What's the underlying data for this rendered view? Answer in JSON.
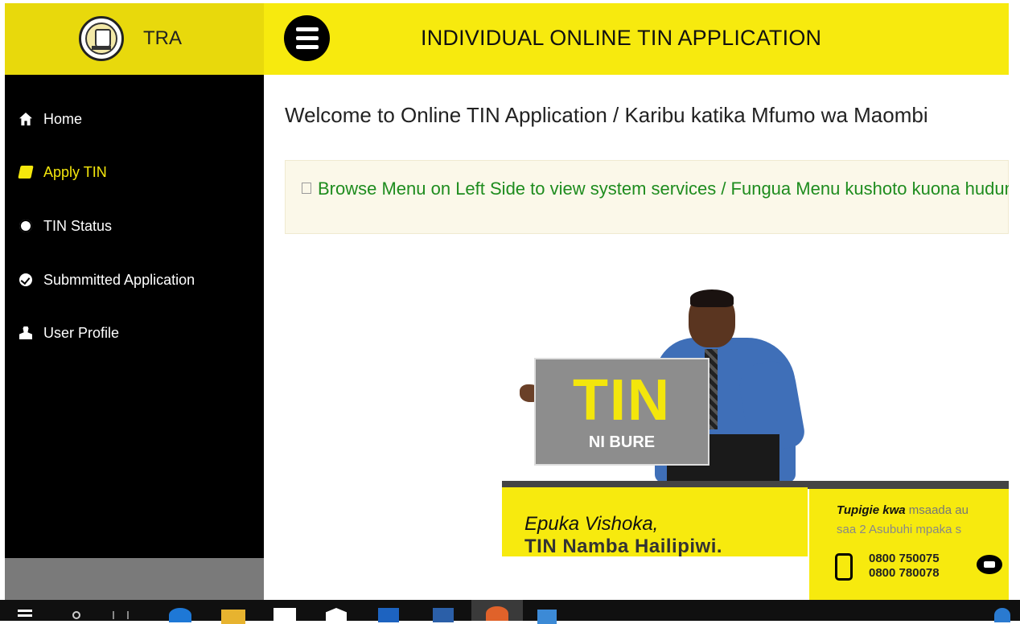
{
  "header": {
    "brand_name": "TRA",
    "title": "INDIVIDUAL ONLINE TIN APPLICATION"
  },
  "sidebar": {
    "items": [
      {
        "label": "Home",
        "icon": "home-icon",
        "active": false
      },
      {
        "label": "Apply TIN",
        "icon": "book-icon",
        "active": true
      },
      {
        "label": "TIN Status",
        "icon": "cog-icon",
        "active": false
      },
      {
        "label": "Submmitted Application",
        "icon": "check-circle-icon",
        "active": false
      },
      {
        "label": "User Profile",
        "icon": "user-icon",
        "active": false
      }
    ]
  },
  "main": {
    "welcome": "Welcome to Online TIN Application / Karibu katika Mfumo wa Maombi",
    "notice": "Browse Menu on Left Side to view system services / Fungua Menu kushoto kuona huduma"
  },
  "banner": {
    "sign_title": "TIN",
    "sign_subtitle": "NI BURE",
    "slogan_line1": "Epuka Vishoka,",
    "slogan_line2": "TIN Namba Hailipiwi.",
    "help_bold": "Tupigie kwa",
    "help_rest": "msaada au",
    "help_line2": "saa 2 Asubuhi mpaka s",
    "phone1": "0800 750075",
    "phone2": "0800 780078"
  },
  "colors": {
    "brand_yellow": "#f7ea0e",
    "sidebar_bg": "#000000",
    "active_item": "#f5e70c",
    "notice_text": "#1e8c1e"
  }
}
